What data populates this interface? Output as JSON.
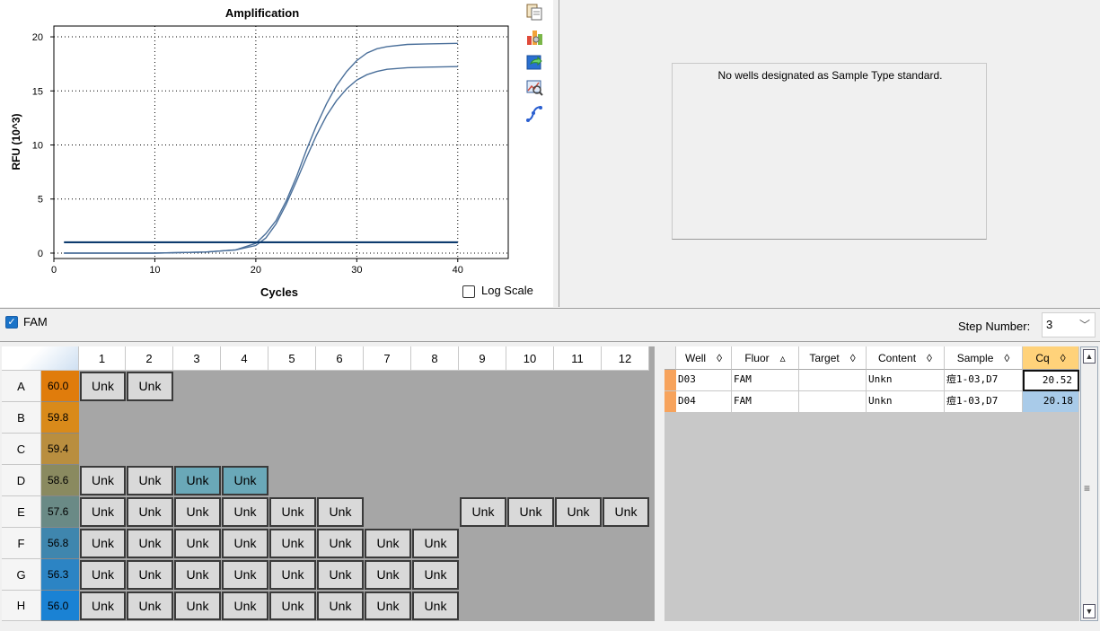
{
  "chart": {
    "title": "Amplification",
    "xlabel": "Cycles",
    "ylabel": "RFU (10^3)",
    "log_scale_label": "Log Scale",
    "log_scale_checked": false
  },
  "chart_data": {
    "type": "line",
    "title": "Amplification",
    "xlabel": "Cycles",
    "ylabel": "RFU (10^3)",
    "xlim": [
      0,
      45
    ],
    "ylim": [
      -0.5,
      21
    ],
    "xticks": [
      0,
      10,
      20,
      30,
      40
    ],
    "yticks": [
      0,
      5,
      10,
      15,
      20
    ],
    "grid": true,
    "series": [
      {
        "x": [
          1,
          5,
          10,
          15,
          18,
          20,
          21,
          22,
          23,
          24,
          25,
          26,
          27,
          28,
          29,
          30,
          31,
          32,
          33,
          35,
          37,
          40
        ],
        "y": [
          0.0,
          0.0,
          0.0,
          0.1,
          0.3,
          0.9,
          1.8,
          3.0,
          4.8,
          7.0,
          9.5,
          11.8,
          13.8,
          15.5,
          16.8,
          17.8,
          18.5,
          18.9,
          19.1,
          19.3,
          19.35,
          19.4
        ],
        "color": "#4a6f9a"
      },
      {
        "x": [
          1,
          5,
          10,
          15,
          18,
          20,
          21,
          22,
          23,
          24,
          25,
          26,
          27,
          28,
          29,
          30,
          31,
          32,
          33,
          35,
          37,
          40
        ],
        "y": [
          0.0,
          0.0,
          0.0,
          0.1,
          0.3,
          0.7,
          1.4,
          2.7,
          4.5,
          6.6,
          8.8,
          10.9,
          12.7,
          14.1,
          15.2,
          16.0,
          16.5,
          16.8,
          17.0,
          17.15,
          17.2,
          17.25
        ],
        "color": "#4a6f9a"
      }
    ],
    "threshold": {
      "y": 1.0,
      "color": "#0d3b6e"
    }
  },
  "standard_curve": {
    "message": "No wells designated as Sample Type standard."
  },
  "filter": {
    "fluor_label": "FAM",
    "fluor_checked": true,
    "step_label": "Step Number:",
    "step_value": "3"
  },
  "plate": {
    "columns": [
      "1",
      "2",
      "3",
      "4",
      "5",
      "6",
      "7",
      "8",
      "9",
      "10",
      "11",
      "12"
    ],
    "rows": [
      {
        "label": "A",
        "temp": "60.0",
        "color": "#e07c0c",
        "wells": [
          "Unk",
          "Unk",
          "",
          "",
          "",
          "",
          "",
          "",
          "",
          "",
          "",
          ""
        ]
      },
      {
        "label": "B",
        "temp": "59.8",
        "color": "#d98a1a",
        "wells": [
          "",
          "",
          "",
          "",
          "",
          "",
          "",
          "",
          "",
          "",
          "",
          ""
        ]
      },
      {
        "label": "C",
        "temp": "59.4",
        "color": "#b98e3f",
        "wells": [
          "",
          "",
          "",
          "",
          "",
          "",
          "",
          "",
          "",
          "",
          "",
          ""
        ]
      },
      {
        "label": "D",
        "temp": "58.6",
        "color": "#8a8a60",
        "wells": [
          "Unk",
          "Unk",
          "Unk",
          "Unk",
          "",
          "",
          "",
          "",
          "",
          "",
          "",
          ""
        ]
      },
      {
        "label": "E",
        "temp": "57.6",
        "color": "#6a8a86",
        "wells": [
          "Unk",
          "Unk",
          "Unk",
          "Unk",
          "Unk",
          "Unk",
          "",
          "",
          "Unk",
          "Unk",
          "Unk",
          "Unk"
        ]
      },
      {
        "label": "F",
        "temp": "56.8",
        "color": "#3f86ae",
        "wells": [
          "Unk",
          "Unk",
          "Unk",
          "Unk",
          "Unk",
          "Unk",
          "Unk",
          "Unk",
          "",
          "",
          "",
          ""
        ]
      },
      {
        "label": "G",
        "temp": "56.3",
        "color": "#2c84c4",
        "wells": [
          "Unk",
          "Unk",
          "Unk",
          "Unk",
          "Unk",
          "Unk",
          "Unk",
          "Unk",
          "",
          "",
          "",
          ""
        ]
      },
      {
        "label": "H",
        "temp": "56.0",
        "color": "#1a82d4",
        "wells": [
          "Unk",
          "Unk",
          "Unk",
          "Unk",
          "Unk",
          "Unk",
          "Unk",
          "Unk",
          "",
          "",
          "",
          ""
        ]
      }
    ],
    "selected": [
      [
        3,
        2
      ],
      [
        3,
        3
      ]
    ]
  },
  "table": {
    "headers": [
      {
        "label": "Well",
        "sort": "◊"
      },
      {
        "label": "Fluor",
        "sort": "▵"
      },
      {
        "label": "Target",
        "sort": "◊"
      },
      {
        "label": "Content",
        "sort": "◊"
      },
      {
        "label": "Sample",
        "sort": "◊"
      },
      {
        "label": "Cq",
        "sort": "◊"
      }
    ],
    "rows": [
      {
        "well": "D03",
        "fluor": "FAM",
        "target": "",
        "content": "Unkn",
        "sample": "痘1-03,D7",
        "cq": "20.52"
      },
      {
        "well": "D04",
        "fluor": "FAM",
        "target": "",
        "content": "Unkn",
        "sample": "痘1-03,D7",
        "cq": "20.18"
      }
    ]
  },
  "toolbar": {
    "icons": [
      "copy-icon",
      "chart-settings-icon",
      "export-icon",
      "zoom-icon",
      "curve-icon"
    ]
  }
}
